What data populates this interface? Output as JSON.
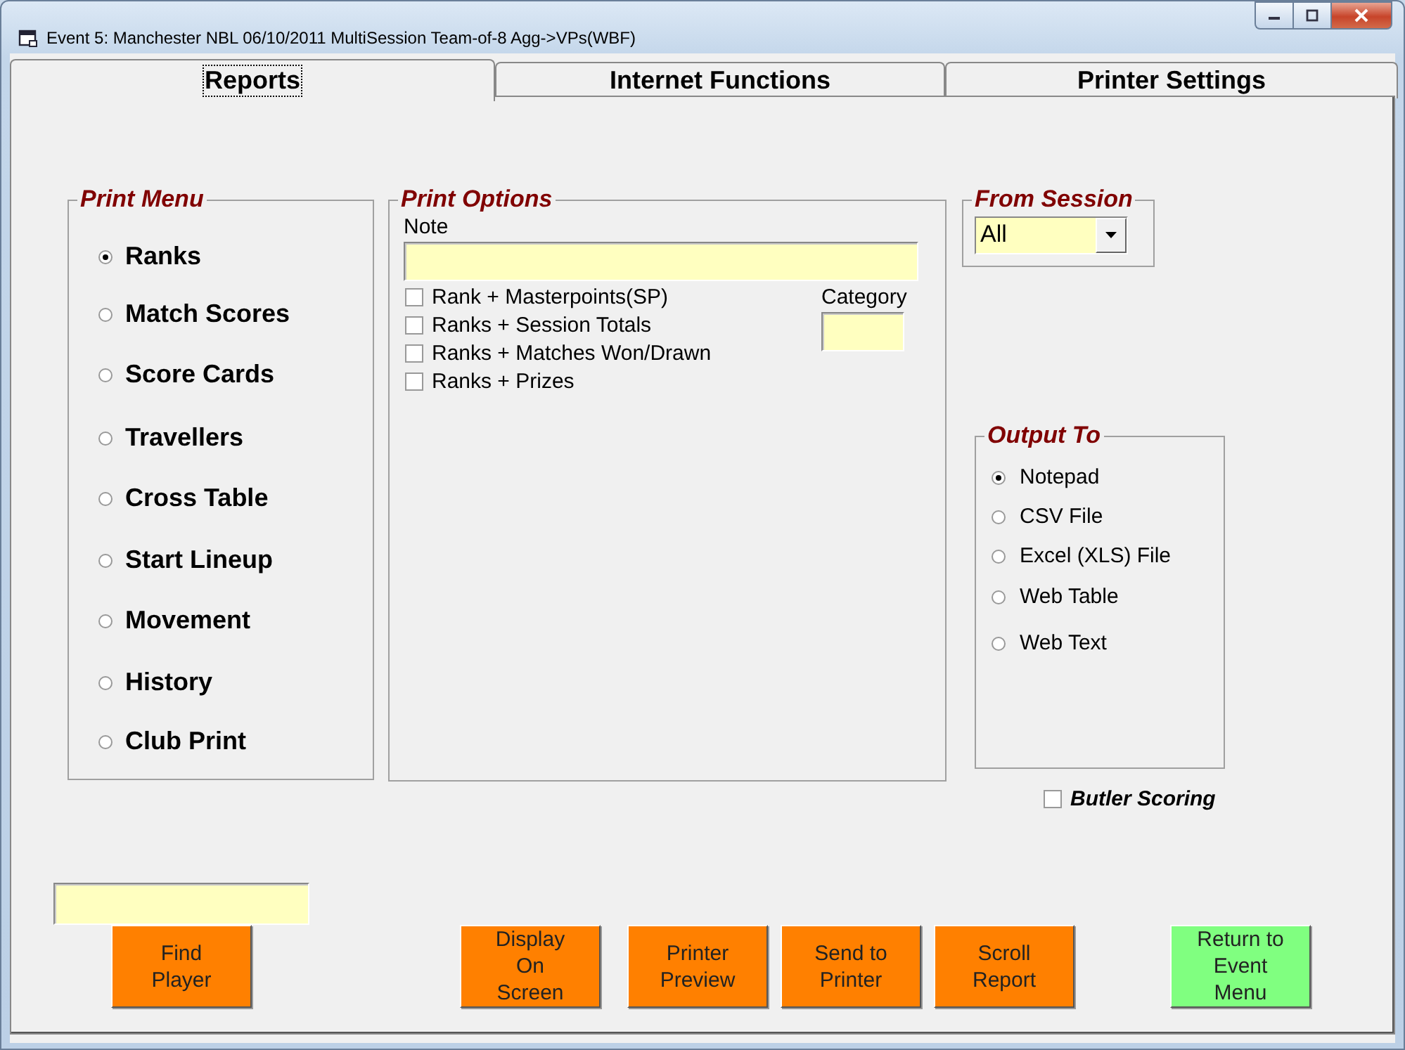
{
  "window": {
    "title": "Event 5: Manchester NBL 06/10/2011 MultiSession Team-of-8 Agg->VPs(WBF)"
  },
  "tabs": [
    {
      "label": "Reports",
      "selected": true
    },
    {
      "label": "Internet Functions",
      "selected": false
    },
    {
      "label": "Printer Settings",
      "selected": false
    }
  ],
  "print_menu": {
    "title": "Print Menu",
    "items": [
      {
        "label": "Ranks",
        "selected": true
      },
      {
        "label": "Match Scores",
        "selected": false
      },
      {
        "label": "Score Cards",
        "selected": false
      },
      {
        "label": "Travellers",
        "selected": false
      },
      {
        "label": "Cross Table",
        "selected": false
      },
      {
        "label": "Start Lineup",
        "selected": false
      },
      {
        "label": "Movement",
        "selected": false
      },
      {
        "label": "History",
        "selected": false
      },
      {
        "label": "Club Print",
        "selected": false
      }
    ]
  },
  "print_options": {
    "title": "Print Options",
    "note_label": "Note",
    "category_label": "Category",
    "options": [
      {
        "label": "Rank + Masterpoints(SP)",
        "checked": false
      },
      {
        "label": "Ranks + Session Totals",
        "checked": false
      },
      {
        "label": "Ranks + Matches Won/Drawn",
        "checked": false
      },
      {
        "label": "Ranks + Prizes",
        "checked": false
      }
    ]
  },
  "from_session": {
    "title": "From Session",
    "value": "All"
  },
  "output_to": {
    "title": "Output To",
    "items": [
      {
        "label": "Notepad",
        "selected": true
      },
      {
        "label": "CSV File",
        "selected": false
      },
      {
        "label": "Excel (XLS) File",
        "selected": false
      },
      {
        "label": "Web Table",
        "selected": false
      },
      {
        "label": "Web Text",
        "selected": false
      }
    ]
  },
  "butler_scoring": {
    "label": "Butler Scoring",
    "checked": false
  },
  "buttons": [
    {
      "label": "Find Player",
      "color": "#ff8000"
    },
    {
      "label": "Display On Screen",
      "color": "#ff8000"
    },
    {
      "label": "Printer Preview",
      "color": "#ff8000"
    },
    {
      "label": "Send to Printer",
      "color": "#ff8000"
    },
    {
      "label": "Scroll Report",
      "color": "#ff8000"
    },
    {
      "label": "Return to Event Menu",
      "color": "#80ff80"
    }
  ]
}
